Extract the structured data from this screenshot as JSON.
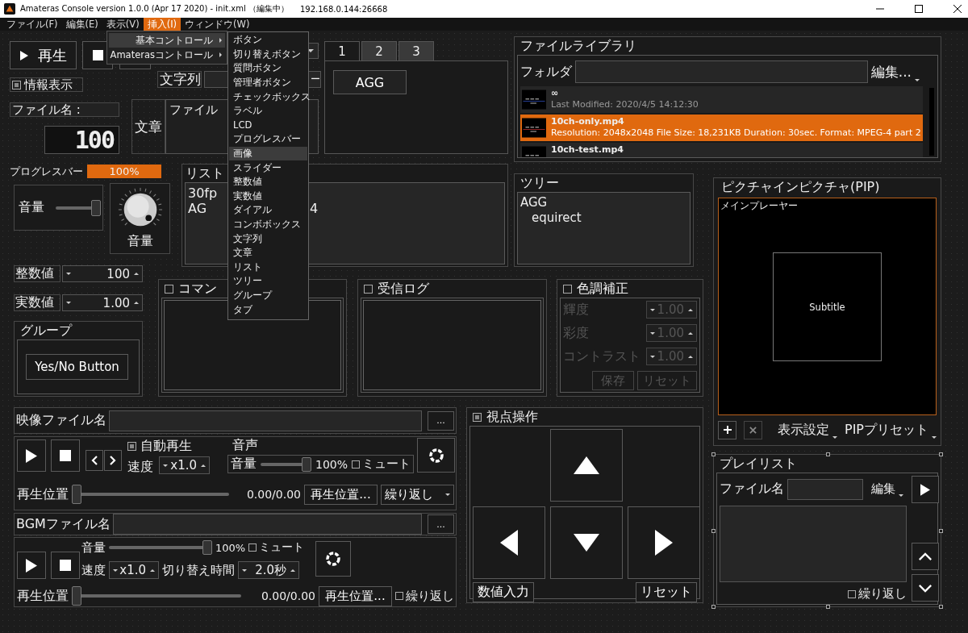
{
  "window": {
    "title": "Amateras Console version 1.0.0 (Apr 17 2020) - init.xml （編集中）",
    "address": "192.168.0.144:26668"
  },
  "menu_bar": [
    {
      "label": "ファイル(F)",
      "selected": false
    },
    {
      "label": "編集(E)",
      "selected": false
    },
    {
      "label": "表示(V)",
      "selected": false
    },
    {
      "label": "挿入(I)",
      "selected": true
    },
    {
      "label": "ウィンドウ(W)",
      "selected": false
    }
  ],
  "insert_menu": [
    {
      "label": "基本コントロール",
      "selected": true
    },
    {
      "label": "Amaterasコントロール",
      "selected": false
    }
  ],
  "submenu": [
    {
      "label": "ボタン",
      "selected": false
    },
    {
      "label": "切り替えボタン",
      "selected": false
    },
    {
      "label": "質問ボタン",
      "selected": false
    },
    {
      "label": "管理者ボタン",
      "selected": false
    },
    {
      "label": "チェックボックス",
      "selected": false
    },
    {
      "label": "ラベル",
      "selected": false
    },
    {
      "label": "LCD",
      "selected": false
    },
    {
      "label": "プログレスバー",
      "selected": false
    },
    {
      "label": "画像",
      "selected": true
    },
    {
      "label": "スライダー",
      "selected": false
    },
    {
      "label": "整数値",
      "selected": false
    },
    {
      "label": "実数値",
      "selected": false
    },
    {
      "label": "ダイアル",
      "selected": false
    },
    {
      "label": "コンボボックス",
      "selected": false
    },
    {
      "label": "文字列",
      "selected": false
    },
    {
      "label": "文章",
      "selected": false
    },
    {
      "label": "リスト",
      "selected": false
    },
    {
      "label": "ツリー",
      "selected": false
    },
    {
      "label": "グループ",
      "selected": false
    },
    {
      "label": "タブ",
      "selected": false
    }
  ],
  "play_button": "再生",
  "info_checkbox": {
    "label": "情報表示",
    "checked": true
  },
  "string_field": {
    "label": "文字列",
    "value": "ー"
  },
  "filename_label": "ファイル名 :",
  "lcd": "100",
  "text_area": {
    "label": "文章",
    "value": "ファイル"
  },
  "tabs": [
    {
      "label": "1",
      "selected": true
    },
    {
      "label": "2",
      "selected": false
    },
    {
      "label": "3",
      "selected": false
    }
  ],
  "tab_button": "AGG",
  "file_library": {
    "title": "ファイルライブラリ",
    "folder_label": "フォルダ",
    "edit_menu": "編集...",
    "files": [
      {
        "name": "∞",
        "details": "Last Modified: 2020/4/5 14:12:30",
        "selected": false
      },
      {
        "name": "10ch-only.mp4",
        "details": "Resolution: 2048x2048 File Size: 18,231KB Duration: 30sec. Format: MPEG-4 part 2",
        "selected": true
      },
      {
        "name": "10ch-test.mp4",
        "selected": false
      }
    ]
  },
  "progress": {
    "label": "プログレスバー",
    "reading": "100%",
    "level": 1
  },
  "volume_slider": {
    "label": "音量",
    "level": 1
  },
  "dial": {
    "label": "音量"
  },
  "list": {
    "title": "リスト",
    "items": [
      {
        "text": "30fp"
      },
      {
        "text": "AG",
        "tail": "4"
      }
    ]
  },
  "tree": {
    "title": "ツリー",
    "nodes": [
      {
        "label": "AGG",
        "children": [
          {
            "label": "equirect"
          }
        ]
      }
    ]
  },
  "pip": {
    "title": "ピクチャインピクチャ(PIP)",
    "player_label": "メインプレーヤー",
    "subtitle": "Subtitle",
    "display_menu": "表示設定",
    "preset_menu": "PIPプリセット"
  },
  "integer": {
    "label": "整数値",
    "value": "100"
  },
  "real": {
    "label": "実数値",
    "value": "1.00"
  },
  "group": {
    "title": "グループ",
    "button": "Yes/No Button"
  },
  "command": {
    "title": "コマン",
    "checked": false
  },
  "receive_log": {
    "title": "受信ログ",
    "checked": false
  },
  "color_correction": {
    "title": "色調補正",
    "checked": false,
    "disabled": true,
    "fields": [
      {
        "label": "輝度",
        "value": "1.00"
      },
      {
        "label": "彩度",
        "value": "1.00"
      },
      {
        "label": "コントラスト",
        "value": "1.00"
      }
    ],
    "buttons": [
      "保存",
      "リセット"
    ]
  },
  "video": {
    "label": "映像ファイル名",
    "browse": "...",
    "autoplay": {
      "label": "自動再生",
      "checked": true
    },
    "speed": {
      "label": "速度",
      "value": "x1.0"
    },
    "audio": {
      "title": "音声",
      "label": "音量",
      "level": 1,
      "reading": "100%",
      "mute": {
        "label": "ミュート",
        "checked": false
      }
    },
    "position": {
      "label": "再生位置",
      "level": 0,
      "reading": "0.00/0.00",
      "button": "再生位置...",
      "repeat": "繰り返し"
    }
  },
  "bgm": {
    "label": "BGMファイル名",
    "browse": "...",
    "volume": {
      "label": "音量",
      "level": 1,
      "reading": "100%",
      "mute": {
        "label": "ミュート",
        "checked": false
      }
    },
    "speed": {
      "label": "速度",
      "value": "x1.0"
    },
    "switch_time": {
      "label": "切り替え時間",
      "value": "2.0秒"
    },
    "position": {
      "label": "再生位置",
      "level": 0,
      "reading": "0.00/0.00",
      "button": "再生位置...",
      "repeat": {
        "label": "繰り返し",
        "checked": false
      }
    }
  },
  "viewpoint": {
    "title": "視点操作",
    "checked": true,
    "numeric_button": "数値入力",
    "reset_button": "リセット"
  },
  "playlist": {
    "title": "プレイリスト",
    "file_label": "ファイル名",
    "edit_menu": "編集",
    "repeat": {
      "label": "繰り返し",
      "checked": false
    }
  }
}
